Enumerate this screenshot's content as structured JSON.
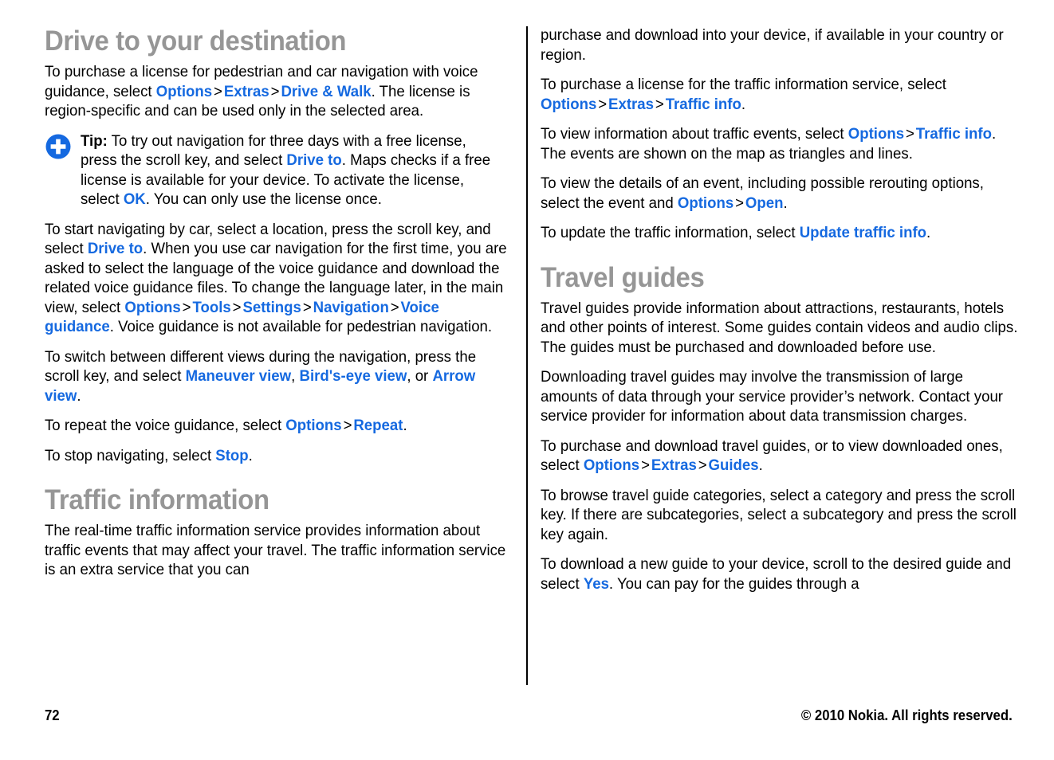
{
  "document": {
    "page_number": "72",
    "copyright": "© 2010 Nokia. All rights reserved.",
    "link_color": "#1569E0",
    "heading_color": "#969696"
  },
  "left_column": {
    "heading_1": "Drive to your destination",
    "para_1": {
      "t1": "To purchase a license for pedestrian and car navigation with voice guidance, select ",
      "l1": "Options",
      "s1": ">",
      "l2": "Extras",
      "s2": ">",
      "l3": "Drive & Walk",
      "t2": ". The license is region-specific and can be used only in the selected area."
    },
    "tip": {
      "icon": "tip-plus-icon",
      "label": "Tip:",
      "t1": " To try out navigation for three days with a free license, press the scroll key, and select ",
      "l1": "Drive to",
      "t2": ". Maps checks if a free license is available for your device. To activate the license, select ",
      "l2": "OK",
      "t3": ". You can only use the license once."
    },
    "para_2": {
      "t1": "To start navigating by car, select a location, press the scroll key, and select ",
      "l1": "Drive to",
      "t2": ". When you use car navigation for the first time, you are asked to select the language of the voice guidance and download the related voice guidance files. To change the language later, in the main view, select ",
      "l2": "Options",
      "s1": ">",
      "l3": "Tools",
      "s2": ">",
      "l4": "Settings",
      "s3": ">",
      "l5": "Navigation",
      "s4": ">",
      "l6": "Voice guidance",
      "t3": ". Voice guidance is not available for pedestrian navigation."
    },
    "para_3": {
      "t1": "To switch between different views during the navigation, press the scroll key, and select ",
      "l1": "Maneuver view",
      "t2": ", ",
      "l2": "Bird's-eye view",
      "t3": ", or ",
      "l3": "Arrow view",
      "t4": "."
    },
    "para_4": {
      "t1": "To repeat the voice guidance, select ",
      "l1": "Options",
      "s1": ">",
      "l2": "Repeat",
      "t2": "."
    },
    "para_5": {
      "t1": "To stop navigating, select ",
      "l1": "Stop",
      "t2": "."
    },
    "heading_2": "Traffic information",
    "para_6": "The real-time traffic information service provides information about traffic events that may affect your travel. The traffic information service is an extra service that you can"
  },
  "right_column": {
    "para_1": "purchase and download into your device, if available in your country or region.",
    "para_2": {
      "t1": "To purchase a license for the traffic information service, select ",
      "l1": "Options",
      "s1": ">",
      "l2": "Extras",
      "s2": ">",
      "l3": "Traffic info",
      "t2": "."
    },
    "para_3": {
      "t1": "To view information about traffic events, select ",
      "l1": "Options",
      "s1": ">",
      "l2": "Traffic info",
      "t2": ". The events are shown on the map as triangles and lines."
    },
    "para_4": {
      "t1": "To view the details of an event, including possible rerouting options, select the event and ",
      "l1": "Options",
      "s1": ">",
      "l2": "Open",
      "t2": "."
    },
    "para_5": {
      "t1": "To update the traffic information, select ",
      "l1": "Update traffic info",
      "t2": "."
    },
    "heading_1": "Travel guides",
    "para_6": "Travel guides provide information about attractions, restaurants, hotels and other points of interest. Some guides contain videos and audio clips. The guides must be purchased and downloaded before use.",
    "para_7": "Downloading travel guides may involve the transmission of large amounts of data through your service provider’s network. Contact your service provider for information about data transmission charges.",
    "para_8": {
      "t1": "To purchase and download travel guides, or to view downloaded ones, select ",
      "l1": "Options",
      "s1": ">",
      "l2": "Extras",
      "s2": ">",
      "l3": "Guides",
      "t2": "."
    },
    "para_9": "To browse travel guide categories, select a category and press the scroll key. If there are subcategories, select a subcategory and press the scroll key again.",
    "para_10": {
      "t1": "To download a new guide to your device, scroll to the desired guide and select ",
      "l1": "Yes",
      "t2": ". You can pay for the guides through a"
    }
  }
}
